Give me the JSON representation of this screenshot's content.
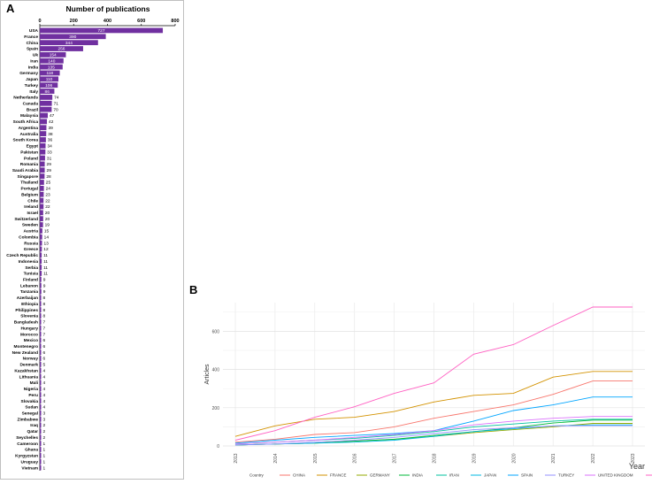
{
  "panels": {
    "a": {
      "letter": "A"
    },
    "b": {
      "letter": "B"
    }
  },
  "colors": {
    "bar": "#7030a0",
    "bar_label": "#ffffff"
  },
  "chart_data": [
    {
      "type": "bar",
      "orientation": "horizontal",
      "title": "Number of publications",
      "xlim": [
        0,
        800
      ],
      "x_ticks": [
        0,
        200,
        400,
        600,
        800
      ],
      "grid": false,
      "categories": [
        "USA",
        "France",
        "China",
        "Spain",
        "Uk",
        "Iran",
        "India",
        "Germany",
        "Japan",
        "Turkey",
        "Italy",
        "Netherlands",
        "Canada",
        "Brazil",
        "Malaysia",
        "South Africa",
        "Argentina",
        "Australia",
        "South Korea",
        "Egypt",
        "Pakistan",
        "Poland",
        "Romania",
        "Saudi Arabia",
        "Singapore",
        "Thailand",
        "Portugal",
        "Belgium",
        "Chile",
        "Ireland",
        "Israel",
        "Switzerland",
        "Sweden",
        "Austria",
        "Colombia",
        "Russia",
        "Greece",
        "Czech Republic",
        "Indonesia",
        "Serbia",
        "Tunisia",
        "Finland",
        "Lebanon",
        "Tanzania",
        "Azerbaijan",
        "Ethiopia",
        "Philippines",
        "Slovenia",
        "Bangladesh",
        "Hungary",
        "Morocco",
        "Mexico",
        "Montenegro",
        "New Zealand",
        "Norway",
        "Denmark",
        "Kazakhstan",
        "Lithuania",
        "Mali",
        "Nigeria",
        "Peru",
        "Slovakia",
        "Sudan",
        "Senegal",
        "Zimbabwe",
        "Iraq",
        "Qatar",
        "Seychelles",
        "Cameroon",
        "Ghana",
        "Kyrgyzstan",
        "Uruguay",
        "Vietnam"
      ],
      "values": [
        727,
        390,
        344,
        256,
        154,
        140,
        135,
        118,
        110,
        106,
        86,
        74,
        71,
        70,
        47,
        42,
        39,
        38,
        36,
        34,
        33,
        31,
        29,
        29,
        28,
        25,
        24,
        23,
        22,
        22,
        20,
        20,
        19,
        15,
        14,
        13,
        12,
        11,
        11,
        11,
        11,
        9,
        9,
        9,
        8,
        8,
        8,
        8,
        7,
        7,
        7,
        6,
        6,
        6,
        6,
        5,
        4,
        4,
        4,
        4,
        4,
        4,
        4,
        3,
        3,
        2,
        2,
        2,
        1,
        1,
        1,
        1,
        1
      ]
    },
    {
      "type": "line",
      "xlabel": "Year",
      "ylabel": "Articles",
      "x": [
        "2013",
        "2014",
        "2015",
        "2016",
        "2017",
        "2018",
        "2019",
        "2020",
        "2021",
        "2022",
        "2023"
      ],
      "ylim": [
        0,
        750
      ],
      "y_ticks": [
        0,
        200,
        400,
        600
      ],
      "grid": true,
      "legend_title": "Country",
      "legend_position": "bottom",
      "series": [
        {
          "name": "CHINA",
          "color": "#f8766d",
          "values": [
            20,
            35,
            60,
            70,
            100,
            145,
            180,
            215,
            270,
            340,
            340
          ]
        },
        {
          "name": "FRANCE",
          "color": "#d39200",
          "values": [
            50,
            105,
            140,
            150,
            180,
            230,
            265,
            275,
            360,
            390,
            390
          ]
        },
        {
          "name": "GERMANY",
          "color": "#93aa00",
          "values": [
            5,
            10,
            15,
            25,
            35,
            50,
            70,
            85,
            100,
            118,
            118
          ]
        },
        {
          "name": "INDIA",
          "color": "#00ba38",
          "values": [
            5,
            10,
            15,
            25,
            35,
            55,
            75,
            95,
            120,
            135,
            135
          ]
        },
        {
          "name": "IRAN",
          "color": "#00c19f",
          "values": [
            10,
            20,
            30,
            40,
            55,
            75,
            100,
            115,
            130,
            140,
            140
          ]
        },
        {
          "name": "JAPAN",
          "color": "#00b9e3",
          "values": [
            5,
            10,
            15,
            20,
            30,
            50,
            75,
            90,
            105,
            110,
            110
          ]
        },
        {
          "name": "SPAIN",
          "color": "#00a5ff",
          "values": [
            15,
            30,
            45,
            55,
            65,
            80,
            130,
            185,
            215,
            256,
            256
          ]
        },
        {
          "name": "TURKEY",
          "color": "#9590ff",
          "values": [
            5,
            10,
            20,
            30,
            45,
            65,
            85,
            95,
            105,
            106,
            106
          ]
        },
        {
          "name": "UNITED KINGDOM",
          "color": "#db72fb",
          "values": [
            10,
            20,
            30,
            45,
            60,
            80,
            110,
            130,
            145,
            154,
            154
          ]
        },
        {
          "name": "USA",
          "color": "#ff61c3",
          "values": [
            30,
            80,
            150,
            205,
            275,
            330,
            480,
            530,
            630,
            727,
            727
          ]
        }
      ]
    }
  ]
}
